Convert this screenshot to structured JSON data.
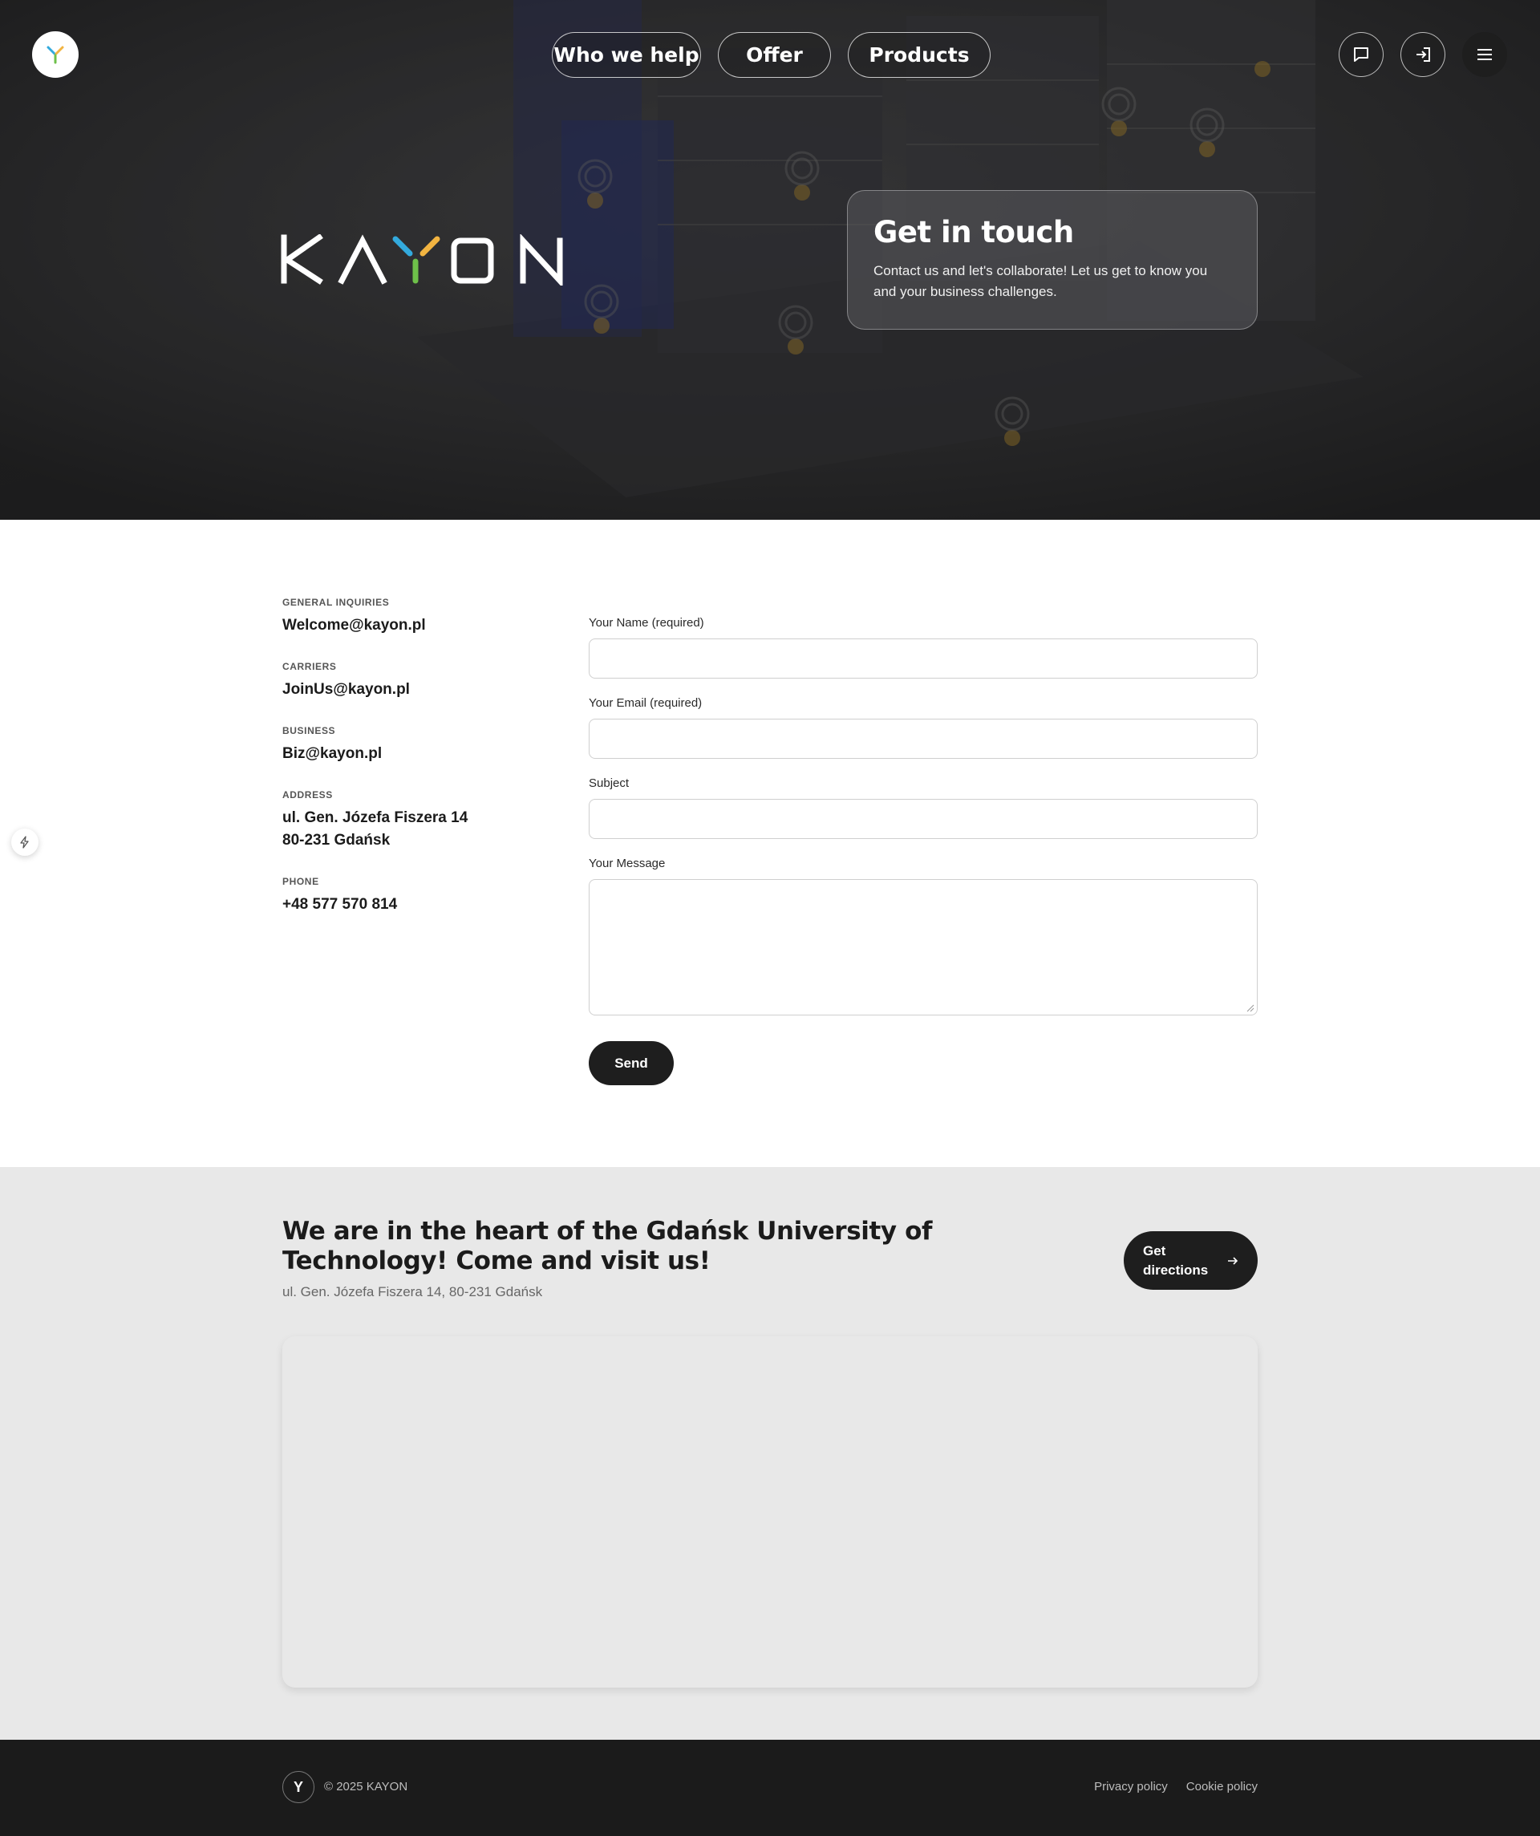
{
  "nav": {
    "items": [
      {
        "label": "Who we help"
      },
      {
        "label": "Offer"
      },
      {
        "label": "Products"
      }
    ]
  },
  "hero": {
    "brand": "KAYON",
    "card_title": "Get in touch",
    "card_text": "Contact us and let's collaborate! Let us get to know you and your business challenges."
  },
  "contact_info": [
    {
      "label": "General inquiries",
      "value": "Welcome@kayon.pl"
    },
    {
      "label": "Carriers",
      "value": "JoinUs@kayon.pl"
    },
    {
      "label": "Business",
      "value": "Biz@kayon.pl"
    },
    {
      "label": "Address",
      "value_line1": "ul. Gen. Józefa Fiszera 14",
      "value_line2": "80-231 Gdańsk"
    },
    {
      "label": "Phone",
      "value": "+48 577 570 814"
    }
  ],
  "form": {
    "name_label": "Your Name (required)",
    "email_label": "Your Email (required)",
    "subject_label": "Subject",
    "message_label": "Your Message",
    "send_label": "Send"
  },
  "visit": {
    "title": "We are in the heart of the Gdańsk University of Technology! Come and visit us!",
    "address": "ul. Gen. Józefa Fiszera 14, 80-231 Gdańsk",
    "directions_label": "Get directions"
  },
  "footer": {
    "logo_letter": "Y",
    "copyright": "© 2025 KAYON",
    "links": [
      {
        "label": "Privacy policy"
      },
      {
        "label": "Cookie policy"
      }
    ]
  },
  "colors": {
    "dark": "#1e1e1e",
    "accent_blue": "#33aadd",
    "accent_yellow": "#f2b441",
    "accent_green": "#6ec04a"
  }
}
